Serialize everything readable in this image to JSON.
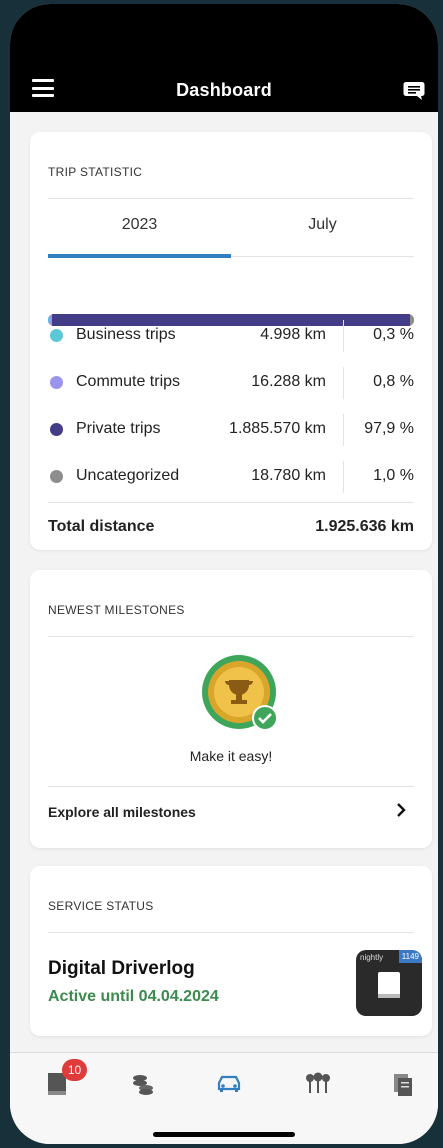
{
  "header": {
    "title": "Dashboard",
    "menu_icon": "hamburger-menu-icon",
    "chat_icon": "chat-bubble-icon"
  },
  "trip_statistic": {
    "title": "TRIP STATISTIC",
    "tabs": [
      {
        "label": "2023",
        "active": true
      },
      {
        "label": "July",
        "active": false
      }
    ],
    "accent_color": "#2f7fc1",
    "rows": [
      {
        "label": "Business trips",
        "km": "4.998 km",
        "pct": "0,3 %",
        "color": "#5bc8d6",
        "share": 0.3
      },
      {
        "label": "Commute trips",
        "km": "16.288 km",
        "pct": "0,8 %",
        "color": "#9b94ef",
        "share": 0.8
      },
      {
        "label": "Private trips",
        "km": "1.885.570 km",
        "pct": "97,9 %",
        "color": "#433d87",
        "share": 97.9
      },
      {
        "label": "Uncategorized",
        "km": "18.780 km",
        "pct": "1,0 %",
        "color": "#8d8d8d",
        "share": 1.0
      }
    ],
    "total_label": "Total distance",
    "total_value": "1.925.636 km"
  },
  "milestones": {
    "title": "NEWEST MILESTONES",
    "latest_label": "Make it easy!",
    "medal_icon": "trophy-medal-icon",
    "explore_label": "Explore all milestones"
  },
  "service": {
    "title": "SERVICE STATUS",
    "name": "Digital Driverlog",
    "status": "Active until 04.04.2024",
    "status_color": "#3b8a4e",
    "app_tag": "nightly",
    "app_build": "1149"
  },
  "bottom_nav": {
    "items": [
      {
        "icon": "logbook-icon",
        "badge": "10"
      },
      {
        "icon": "coins-icon"
      },
      {
        "icon": "car-icon",
        "active": true
      },
      {
        "icon": "pins-icon"
      },
      {
        "icon": "documents-icon"
      }
    ]
  }
}
